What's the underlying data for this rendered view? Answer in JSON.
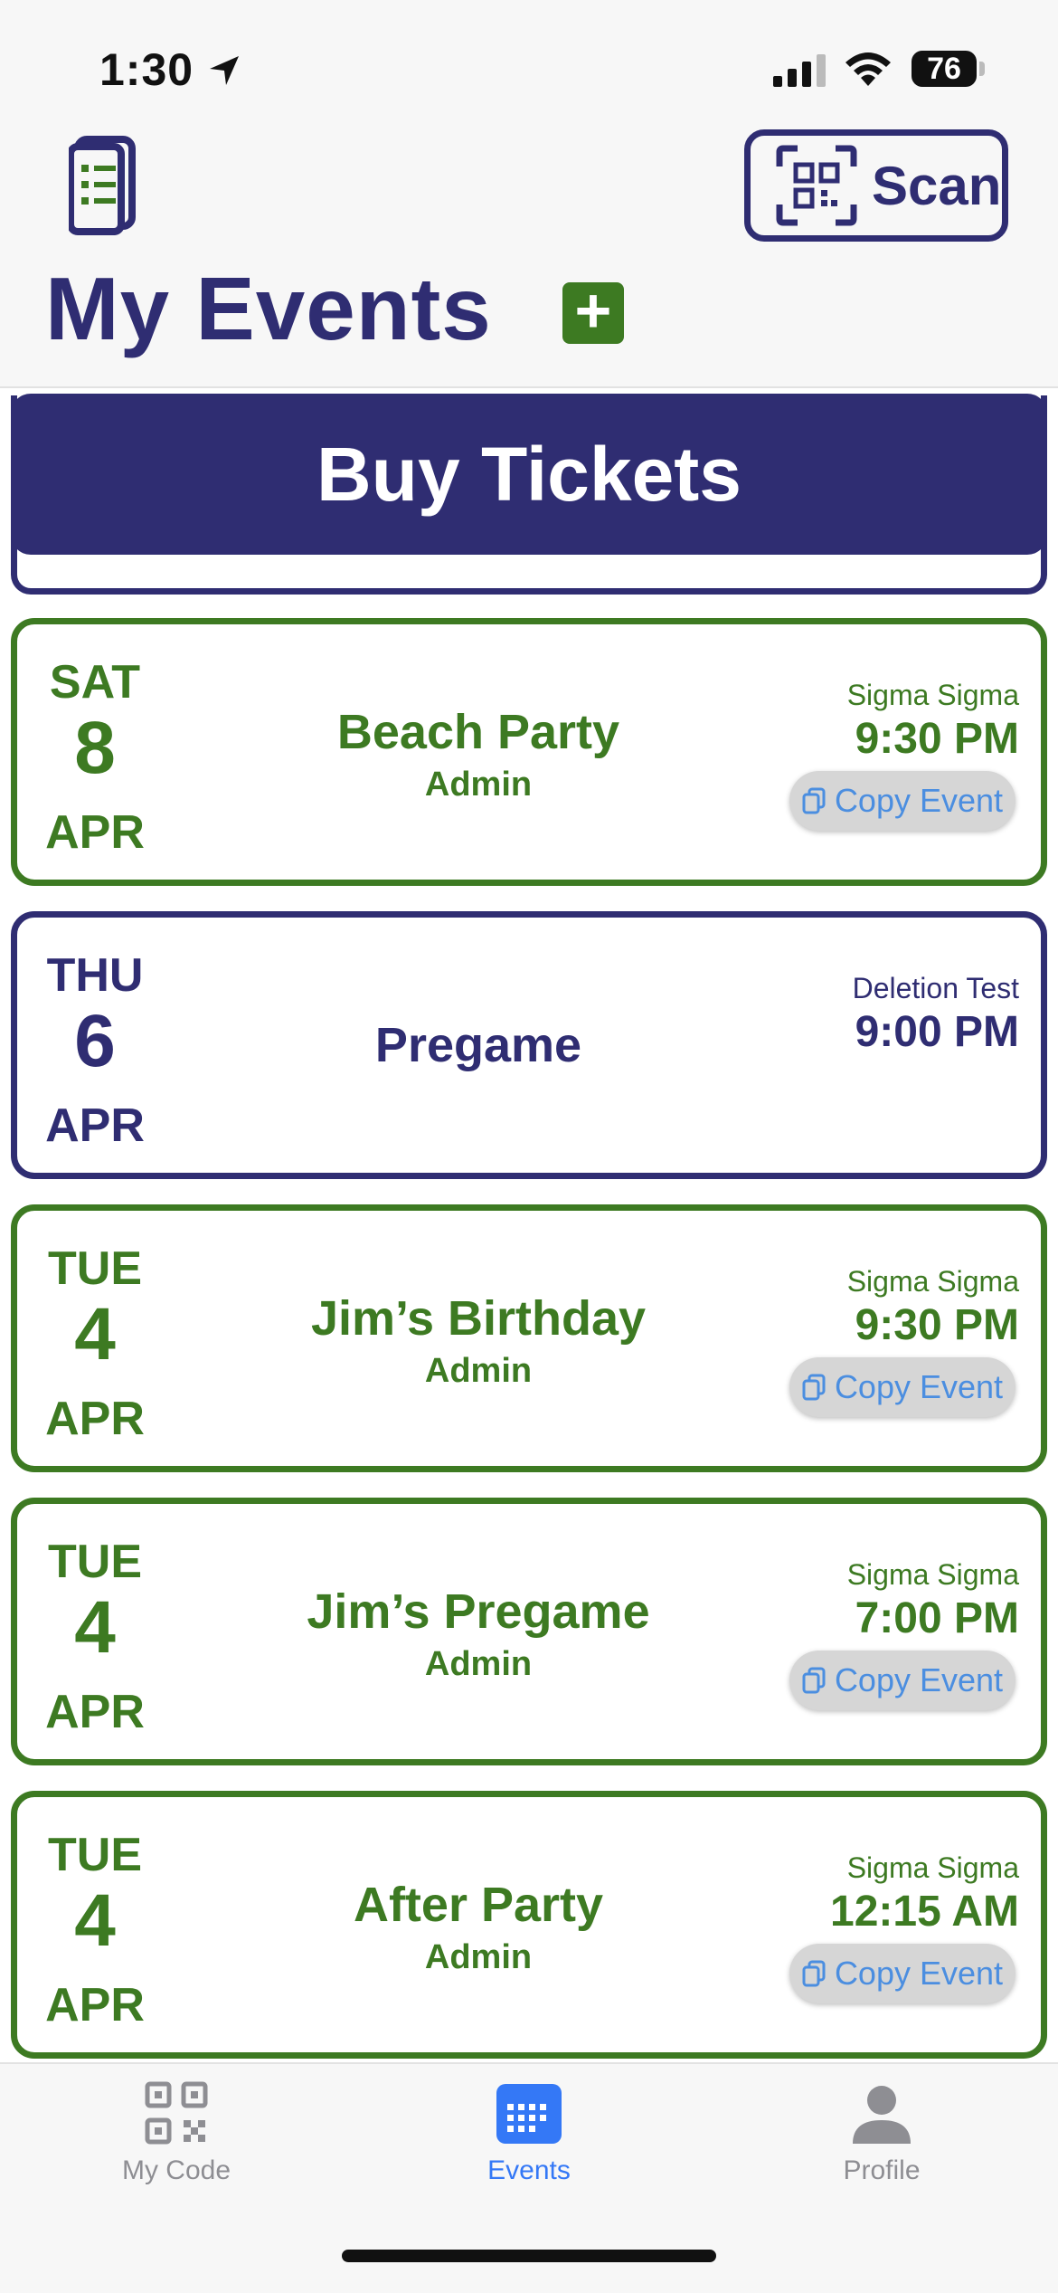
{
  "status_bar": {
    "time": "1:30",
    "battery": "76"
  },
  "header": {
    "title": "My Events",
    "scan_label": "Scan",
    "add_symbol": "+"
  },
  "buy_tickets_label": "Buy Tickets",
  "events": [
    {
      "dow": "SAT",
      "day": "8",
      "month": "APR",
      "name": "Beach Party",
      "role": "Admin",
      "org": "Sigma Sigma",
      "time": "9:30 PM",
      "copy_label": "Copy Event",
      "color": "#3d7a22"
    },
    {
      "dow": "THU",
      "day": "6",
      "month": "APR",
      "name": "Pregame",
      "role": "",
      "org": "Deletion Test",
      "time": "9:00 PM",
      "copy_label": "",
      "color": "#2f2d72"
    },
    {
      "dow": "TUE",
      "day": "4",
      "month": "APR",
      "name": "Jim’s Birthday",
      "role": "Admin",
      "org": "Sigma Sigma",
      "time": "9:30 PM",
      "copy_label": "Copy Event",
      "color": "#3d7a22"
    },
    {
      "dow": "TUE",
      "day": "4",
      "month": "APR",
      "name": "Jim’s Pregame",
      "role": "Admin",
      "org": "Sigma Sigma",
      "time": "7:00 PM",
      "copy_label": "Copy Event",
      "color": "#3d7a22"
    },
    {
      "dow": "TUE",
      "day": "4",
      "month": "APR",
      "name": "After Party",
      "role": "Admin",
      "org": "Sigma Sigma",
      "time": "12:15 AM",
      "copy_label": "Copy Event",
      "color": "#3d7a22"
    }
  ],
  "tabs": [
    {
      "label": "My Code",
      "icon": "qr-code-icon",
      "active": false
    },
    {
      "label": "Events",
      "icon": "calendar-icon",
      "active": true
    },
    {
      "label": "Profile",
      "icon": "person-icon",
      "active": false
    }
  ],
  "colors": {
    "navy": "#2f2d72",
    "green": "#3d7a22",
    "active_tab": "#3478f6",
    "inactive_tab": "#8e8e93",
    "copy_text": "#4b8ee0"
  }
}
